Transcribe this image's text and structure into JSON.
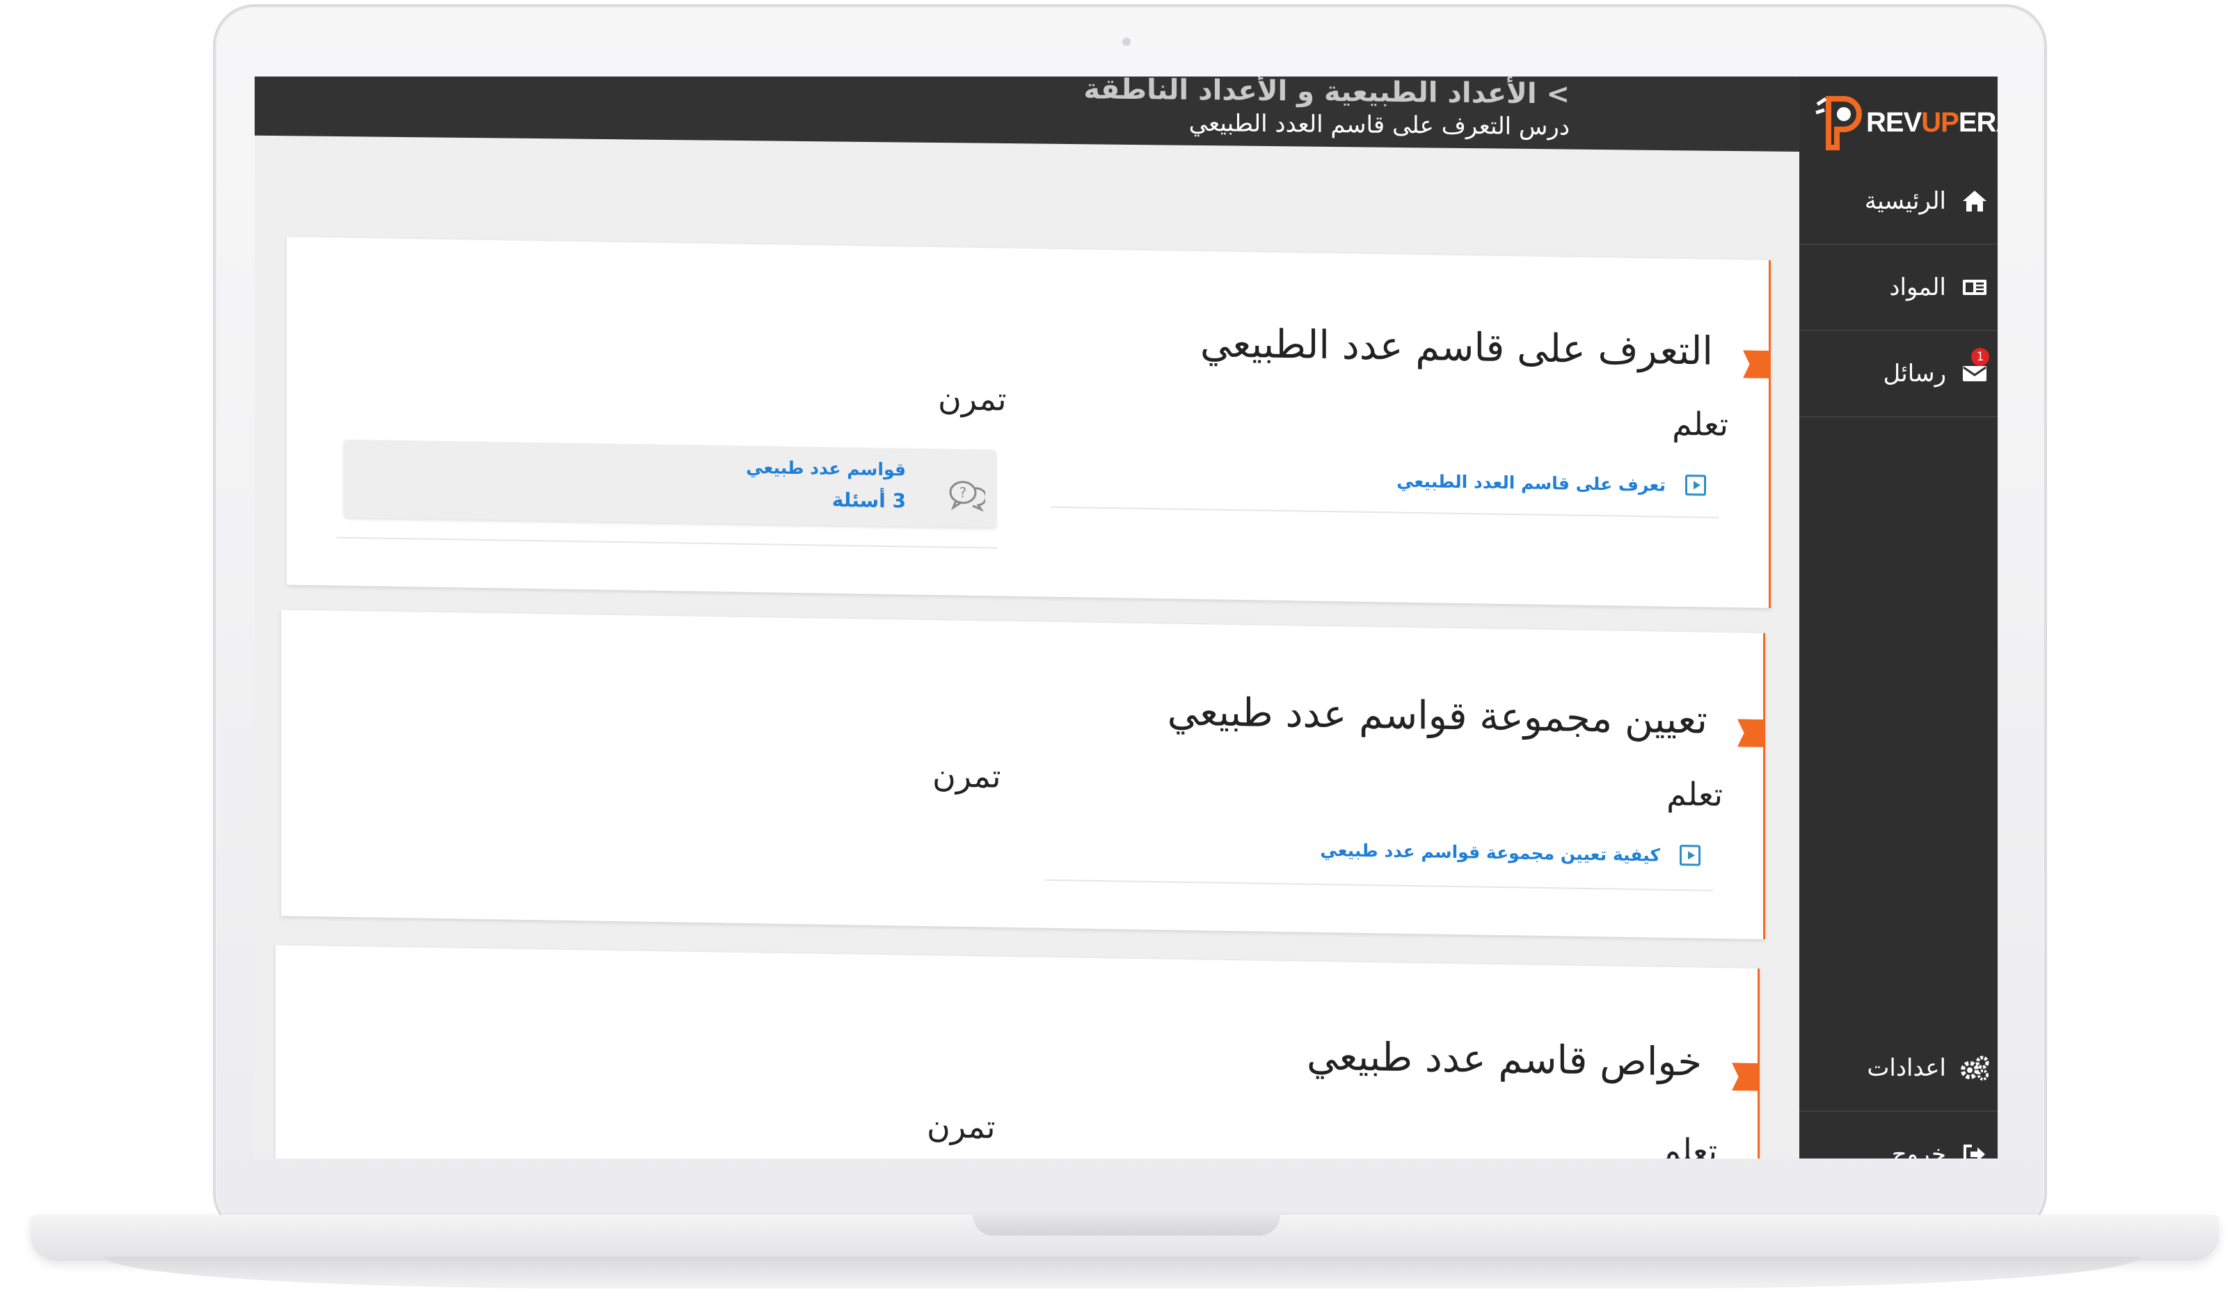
{
  "header": {
    "breadcrumb": "> الأعداد الطبيعية و الأعداد الناطقة",
    "subtitle": "درس التعرف على قاسم العدد الطبيعي"
  },
  "brand": {
    "name_main": "REV",
    "name_accent": "UP",
    "name_tail": "ERA"
  },
  "sidebar": {
    "items": [
      {
        "label": "الرئيسية",
        "icon": "home-icon"
      },
      {
        "label": "المواد",
        "icon": "subjects-icon"
      },
      {
        "label": "رسائل",
        "icon": "envelope-icon",
        "badge": "1"
      }
    ],
    "bottom_items": [
      {
        "label": "اعدادات",
        "icon": "gears-icon"
      },
      {
        "label": "خروج",
        "icon": "logout-icon"
      }
    ]
  },
  "lessons": [
    {
      "title": "التعرف على قاسم عدد الطبيعي",
      "learn_heading": "تعلم",
      "practice_heading": "تمرن",
      "learn_link": "تعرف على قاسم العدد الطبيعي",
      "quiz": {
        "title": "قواسم عدد طبيعي",
        "count": "3 أسئلة"
      }
    },
    {
      "title": "تعيين مجموعة قواسم عدد طبيعي",
      "learn_heading": "تعلم",
      "practice_heading": "تمرن",
      "learn_link": "كيفية تعيين مجموعة قواسم عدد طبيعي"
    },
    {
      "title": "خواص قاسم عدد طبيعي",
      "learn_heading": "تعلم",
      "practice_heading": "تمرن"
    }
  ],
  "colors": {
    "accent": "#f26a21",
    "link": "#1f7fd8",
    "sidebar": "#2f2f2f",
    "topbar": "#333333"
  }
}
